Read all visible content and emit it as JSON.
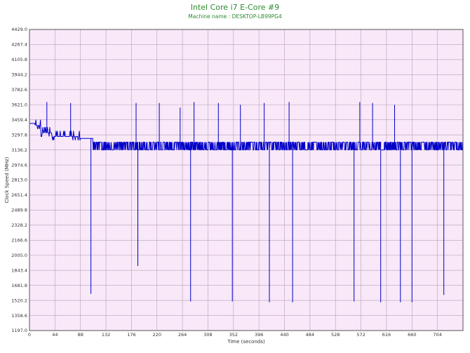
{
  "title": "Intel Core i7 E-Core #9",
  "subtitle": "Machine name : DESKTOP-LB99PG4",
  "chart_data": {
    "type": "line",
    "title": "Intel Core i7 E-Core #9",
    "subtitle": "Machine name : DESKTOP-LB99PG4",
    "xlabel": "Time (seconds)",
    "ylabel": "Clock Speed (MHz)",
    "xlim": [
      0,
      748
    ],
    "ylim": [
      1197.0,
      4429.0
    ],
    "x_ticks": [
      "0",
      "44",
      "88",
      "132",
      "176",
      "220",
      "264",
      "308",
      "352",
      "396",
      "440",
      "484",
      "528",
      "572",
      "616",
      "660",
      "704"
    ],
    "y_ticks": [
      "1197.0",
      "1358.6",
      "1520.2",
      "1681.8",
      "1843.4",
      "2005.0",
      "2166.6",
      "2328.2",
      "2489.8",
      "2651.4",
      "2813.0",
      "2974.6",
      "3136.2",
      "3297.8",
      "3459.4",
      "3621.0",
      "3782.6",
      "3944.2",
      "4105.8",
      "4267.4",
      "4429.0"
    ],
    "grid": true,
    "background_color": "#f8e8f8",
    "grid_color": "#b8a0b8",
    "line_color": "#0000c8",
    "series": [
      {
        "baseline_segments": [
          [
            0,
            3420
          ],
          [
            10,
            3400
          ],
          [
            20,
            3320
          ],
          [
            40,
            3280
          ],
          [
            88,
            3260
          ],
          [
            110,
            3200
          ]
        ],
        "steady_low": 3136.2,
        "steady_high": 3220,
        "noise_start": 110,
        "spikes_up": [
          [
            30,
            3650
          ],
          [
            71,
            3640
          ],
          [
            184,
            3640
          ],
          [
            224,
            3640
          ],
          [
            260,
            3590
          ],
          [
            284,
            3650
          ],
          [
            326,
            3640
          ],
          [
            364,
            3620
          ],
          [
            405,
            3640
          ],
          [
            448,
            3650
          ],
          [
            570,
            3650
          ],
          [
            592,
            3640
          ],
          [
            630,
            3620
          ]
        ],
        "spikes_down": [
          [
            106,
            1590
          ],
          [
            187,
            1890
          ],
          [
            278,
            1510
          ],
          [
            350,
            1510
          ],
          [
            414,
            1500
          ],
          [
            454,
            1500
          ],
          [
            560,
            1510
          ],
          [
            606,
            1500
          ],
          [
            640,
            1500
          ],
          [
            660,
            1500
          ],
          [
            715,
            1580
          ]
        ]
      }
    ]
  }
}
